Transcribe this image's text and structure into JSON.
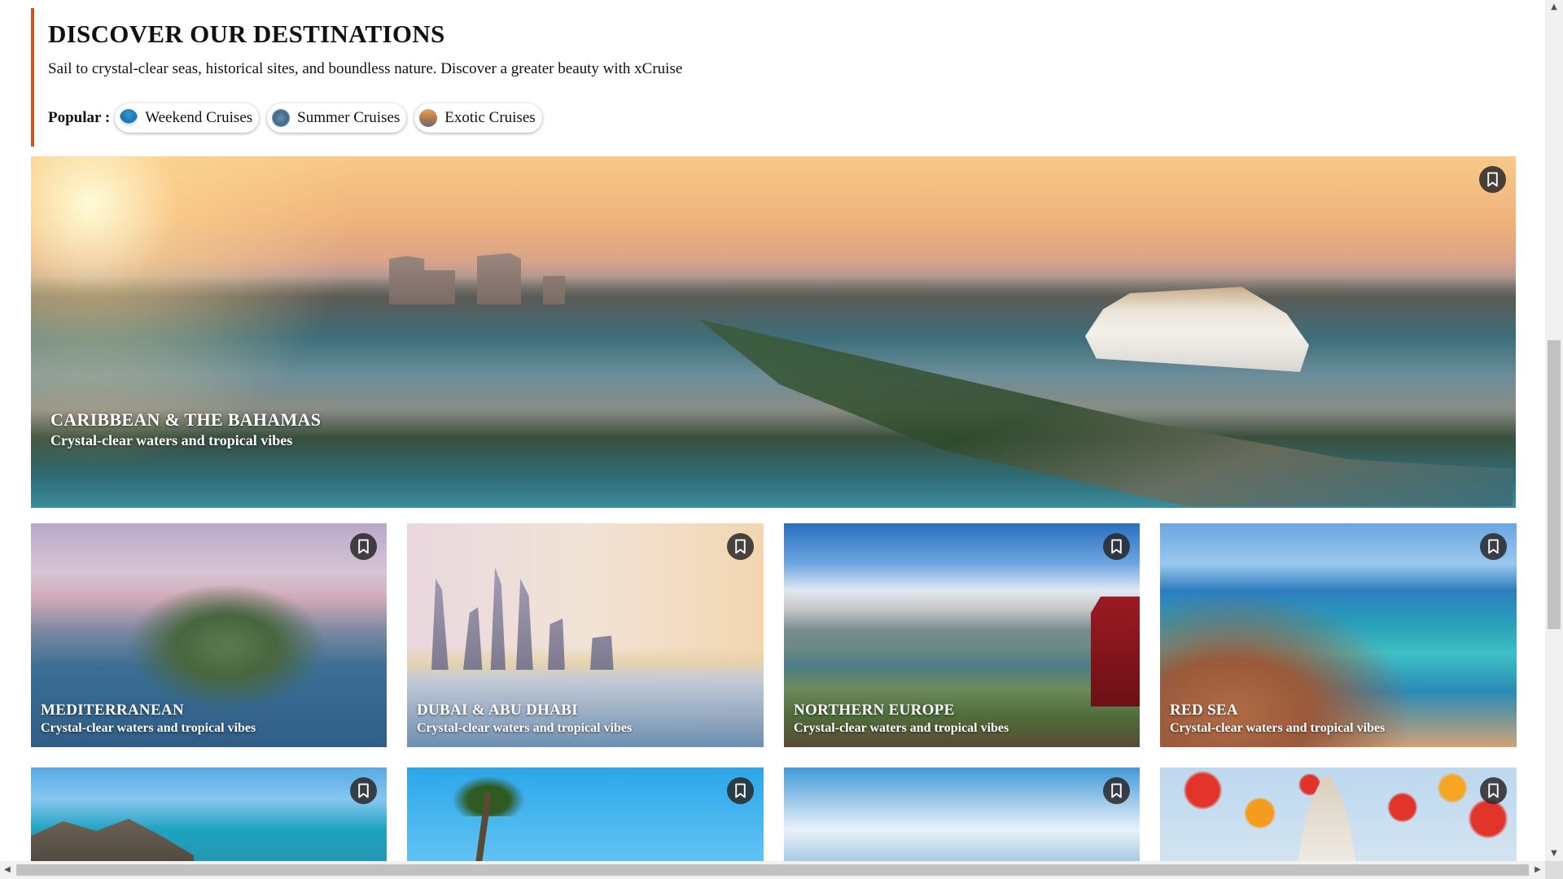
{
  "header": {
    "title": "DISCOVER OUR DESTINATIONS",
    "subtitle": "Sail to crystal-clear seas, historical sites, and boundless nature. Discover a greater beauty with xCruise",
    "popular_label": "Popular :",
    "chips": [
      {
        "label": "Weekend Cruises",
        "icon": "weekend-thumb-icon"
      },
      {
        "label": "Summer Cruises",
        "icon": "summer-thumb-icon"
      },
      {
        "label": "Exotic Cruises",
        "icon": "exotic-thumb-icon"
      }
    ]
  },
  "accent_color": "#c8581e",
  "destinations": {
    "hero": {
      "name": "CARIBBEAN & THE BAHAMAS",
      "tagline": "Crystal-clear waters and tropical vibes"
    },
    "row2": [
      {
        "name": "MEDITERRANEAN",
        "tagline": "Crystal-clear waters and tropical vibes"
      },
      {
        "name": "DUBAI & ABU DHABI",
        "tagline": "Crystal-clear waters and tropical vibes"
      },
      {
        "name": "NORTHERN EUROPE",
        "tagline": "Crystal-clear waters and tropical vibes"
      },
      {
        "name": "RED SEA",
        "tagline": "Crystal-clear waters and tropical vibes"
      }
    ]
  },
  "icons": {
    "bookmark": "bookmark-icon",
    "scroll_up": "▲",
    "scroll_down": "▼",
    "scroll_left": "◀",
    "scroll_right": "▶"
  }
}
